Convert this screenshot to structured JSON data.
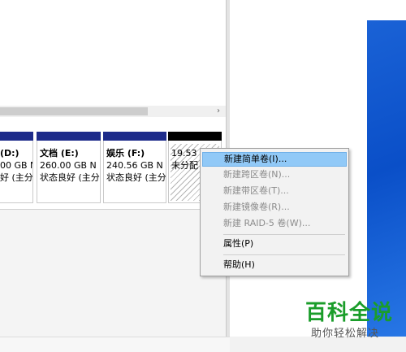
{
  "colors": {
    "volume_bar": "#1d2b8a",
    "unallocated_bar": "#000000",
    "menu_highlight": "#91c9f7",
    "watermark_green": "#1a9d2a",
    "desktop_blue": "#1a62d6"
  },
  "scrollbar": {
    "right_arrow": "›"
  },
  "volumes": [
    {
      "name": "(D:)",
      "size": "00 GB N",
      "status": "好 (主分"
    },
    {
      "name": "文档 (E:)",
      "size": "260.00 GB N",
      "status": "状态良好 (主分"
    },
    {
      "name": "娱乐 (F:)",
      "size": "240.56 GB N",
      "status": "状态良好 (主分"
    },
    {
      "name": "",
      "size": "19.53",
      "status": "未分配"
    }
  ],
  "context_menu": {
    "items": [
      {
        "label": "新建简单卷(I)...",
        "enabled": true,
        "highlighted": true
      },
      {
        "label": "新建跨区卷(N)...",
        "enabled": false
      },
      {
        "label": "新建带区卷(T)...",
        "enabled": false
      },
      {
        "label": "新建镜像卷(R)...",
        "enabled": false
      },
      {
        "label": "新建 RAID-5 卷(W)...",
        "enabled": false
      },
      {
        "label": "属性(P)",
        "enabled": true
      },
      {
        "label": "帮助(H)",
        "enabled": true
      }
    ]
  },
  "watermark": {
    "title": "百科全说",
    "subtitle": "助你轻松解决"
  }
}
